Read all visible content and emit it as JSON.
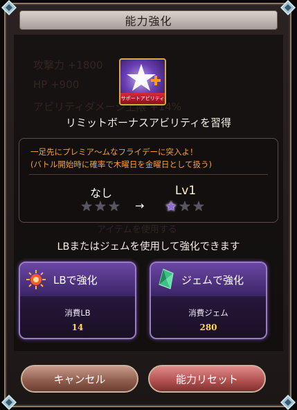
{
  "dialog": {
    "title": "能力強化",
    "skill_icon_label": "サポートアビリティ",
    "heading": "リミットボーナスアビリティを習得",
    "description_line1": "一足先にプレミア～ムなフライデーに突入よ！",
    "description_line2": "(バトル開始時に確率で木曜日を金曜日として扱う)",
    "level_before": "なし",
    "level_after": "Lv1",
    "stars_before_filled": 0,
    "stars_after_filled": 1,
    "stars_total": 3,
    "arrow": "→",
    "prompt": "LBまたはジェムを使用して強化できます"
  },
  "background_ghost": {
    "row1": "攻撃力 +1800",
    "row2": "HP +900",
    "row3": "アビリティダメージ上限 +14%",
    "row4": "アイテムを使用する"
  },
  "cards": {
    "lb": {
      "title": "LBで強化",
      "cost_label": "消費LB",
      "cost_value": "14",
      "icon": "lb-burst-icon"
    },
    "gem": {
      "title": "ジェムで強化",
      "cost_label": "消費ジェム",
      "cost_value": "280",
      "icon": "gem-icon"
    }
  },
  "buttons": {
    "cancel": "キャンセル",
    "reset": "能力リセット"
  },
  "colors": {
    "accent_text": "#f0a23a",
    "cost_value": "#ffd84a",
    "card_border": "#9a7cc4",
    "star_filled": "#8e6ad8"
  }
}
